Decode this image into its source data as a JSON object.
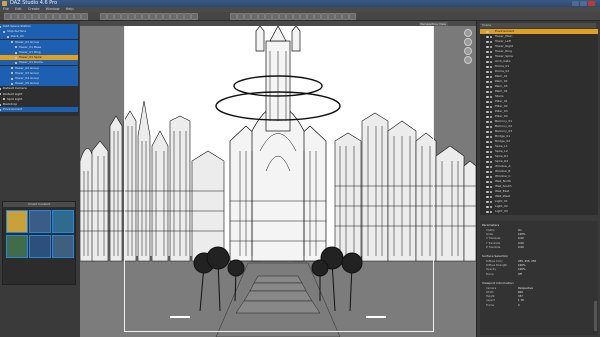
{
  "window": {
    "title": "DAZ Studio 4.6 Pro"
  },
  "menu": [
    "File",
    "Edit",
    "Create",
    "Window",
    "Help"
  ],
  "scene_tree": {
    "rows": [
      {
        "label": "DAZ Space Station",
        "indent": 2,
        "state": "sel"
      },
      {
        "label": "Ship-Surface",
        "indent": 6,
        "state": "sel"
      },
      {
        "label": "Deck_01",
        "indent": 10,
        "state": "sel"
      },
      {
        "label": "Tower_01 Group",
        "indent": 14,
        "state": "sel"
      },
      {
        "label": "Tower_01 Base",
        "indent": 18,
        "state": "sel"
      },
      {
        "label": "Tower_01 Ring",
        "indent": 18,
        "state": "sel"
      },
      {
        "label": "Tower_01 Spire",
        "indent": 18,
        "state": "hl"
      },
      {
        "label": "Tower_01 Dome",
        "indent": 18,
        "state": "sel"
      },
      {
        "label": "Tower_02 Group",
        "indent": 14,
        "state": "sel"
      },
      {
        "label": "Tower_03 Group",
        "indent": 14,
        "state": "sel"
      },
      {
        "label": "Tower_04 Group",
        "indent": 14,
        "state": "sel"
      },
      {
        "label": "Tower_05 Group",
        "indent": 14,
        "state": "sel"
      },
      {
        "label": "Default Camera",
        "indent": 2,
        "state": ""
      },
      {
        "label": "Distant Light",
        "indent": 2,
        "state": ""
      },
      {
        "label": "Spot Light",
        "indent": 6,
        "state": ""
      },
      {
        "label": "Backdrop",
        "indent": 2,
        "state": ""
      },
      {
        "label": "Environment",
        "indent": 2,
        "state": "sel"
      }
    ]
  },
  "content_library": {
    "title": "Smart Content",
    "thumbs": [
      {
        "label": "Preset 1",
        "bg": "#c9a13a"
      },
      {
        "label": "Preset 2",
        "bg": "#3b5c86"
      },
      {
        "label": "Preset 3",
        "bg": "#2f6b8f"
      },
      {
        "label": "Preset 4",
        "bg": "#426b4a"
      },
      {
        "label": "Preset 5",
        "bg": "#2d4f7c"
      },
      {
        "label": "Preset 6",
        "bg": "#3f5f7e"
      }
    ]
  },
  "viewport": {
    "camera": "Perspective View"
  },
  "scene_list": {
    "title": "Scene",
    "rows": [
      "City_Ground",
      "Tower_Main",
      "Tower_Left",
      "Tower_Right",
      "Tower_Ring",
      "Tower_Spire",
      "Arch_Gate",
      "Dome_01",
      "Dome_02",
      "Palm_01",
      "Palm_02",
      "Palm_03",
      "Palm_04",
      "Stairs",
      "Pillar_01",
      "Pillar_02",
      "Pillar_03",
      "Pillar_04",
      "Balcony_01",
      "Balcony_02",
      "Balcony_03",
      "Bridge_01",
      "Bridge_02",
      "Spire_L1",
      "Spire_L2",
      "Spire_R1",
      "Spire_R2",
      "Window_A",
      "Window_B",
      "Window_C",
      "Wall_North",
      "Wall_South",
      "Wall_East",
      "Wall_West",
      "Light_01",
      "Light_02",
      "Light_03"
    ],
    "highlight_index": 0,
    "highlight_label": "Environment"
  },
  "properties": {
    "sections": [
      {
        "title": "Parameters",
        "rows": [
          [
            "Visible",
            "On"
          ],
          [
            "Scale",
            "100%"
          ],
          [
            "X Translate",
            "0.00"
          ],
          [
            "Y Translate",
            "0.00"
          ],
          [
            "Z Translate",
            "0.00"
          ]
        ]
      },
      {
        "title": "Surface Selection",
        "rows": [
          [
            "Diffuse Color",
            "255, 255, 255"
          ],
          [
            "Diffuse Strength",
            "100%"
          ],
          [
            "Opacity",
            "100%"
          ],
          [
            "Bump",
            "Off"
          ]
        ]
      },
      {
        "title": "Viewport Information",
        "rows": [
          [
            "Camera",
            "Perspective"
          ],
          [
            "Width",
            "600"
          ],
          [
            "Height",
            "337"
          ],
          [
            "Aspect",
            "1.78"
          ],
          [
            "Frame",
            "0"
          ]
        ]
      }
    ]
  }
}
